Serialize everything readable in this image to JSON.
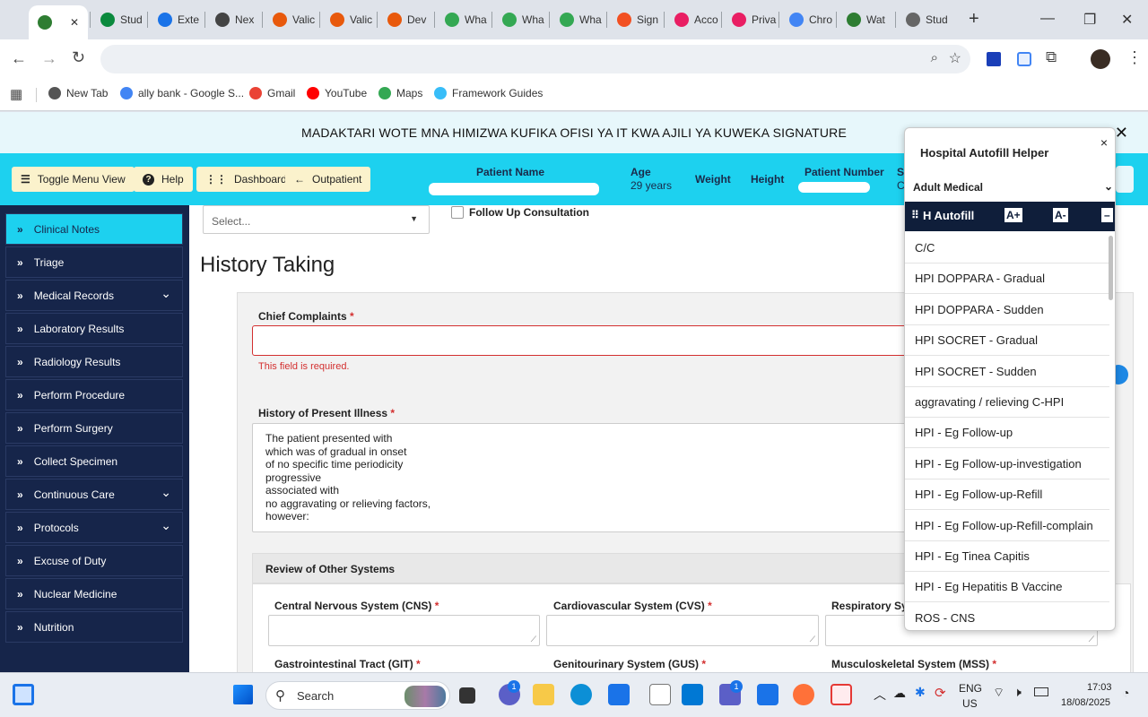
{
  "browser": {
    "tabs": [
      {
        "label": "",
        "color": "#2e7d32"
      },
      {
        "label": "Stud",
        "color": "#0b8a3e"
      },
      {
        "label": "Exte",
        "color": "#1a73e8"
      },
      {
        "label": "Nex",
        "color": "#444444"
      },
      {
        "label": "Valic",
        "color": "#e8590c"
      },
      {
        "label": "Valic",
        "color": "#e8590c"
      },
      {
        "label": "Dev",
        "color": "#e8590c"
      },
      {
        "label": "Wha",
        "color": "#34a853"
      },
      {
        "label": "Wha",
        "color": "#34a853"
      },
      {
        "label": "Wha",
        "color": "#34a853"
      },
      {
        "label": "Sign",
        "color": "#f25022"
      },
      {
        "label": "Acco",
        "color": "#e91e63"
      },
      {
        "label": "Priva",
        "color": "#e91e63"
      },
      {
        "label": "Chro",
        "color": "#4285f4"
      },
      {
        "label": "Wat",
        "color": "#2e7d32"
      },
      {
        "label": "Stud",
        "color": "#666666"
      }
    ],
    "new_tab_symbol": "+",
    "bookmarks": [
      {
        "label": "New Tab",
        "color": "#555555"
      },
      {
        "label": "ally bank - Google S...",
        "color": "#4285f4"
      },
      {
        "label": "Gmail",
        "color": "#ea4335"
      },
      {
        "label": "YouTube",
        "color": "#ff0000"
      },
      {
        "label": "Maps",
        "color": "#34a853"
      },
      {
        "label": "Framework Guides",
        "color": "#38bdf8"
      }
    ]
  },
  "banner": {
    "text": "MADAKTARI WOTE MNA HIMIZWA KUFIKA OFISI YA IT KWA AJILI YA KUWEKA SIGNATURE",
    "close": "✕"
  },
  "topbar": {
    "buttons": {
      "toggle": "Toggle Menu View",
      "help": "Help",
      "dashboard": "Dashboard",
      "outpatient": "Outpatient"
    },
    "patient": {
      "name_label": "Patient Name",
      "age_label": "Age",
      "age_value": "29 years",
      "weight_label": "Weight",
      "height_label": "Height",
      "number_label": "Patient Number",
      "s_label": "S",
      "s_value": "C"
    }
  },
  "sidebar": {
    "items": [
      {
        "label": "Clinical Notes",
        "dropdown": false
      },
      {
        "label": "Triage",
        "dropdown": false
      },
      {
        "label": "Medical Records",
        "dropdown": true
      },
      {
        "label": "Laboratory Results",
        "dropdown": false
      },
      {
        "label": "Radiology Results",
        "dropdown": false
      },
      {
        "label": "Perform Procedure",
        "dropdown": false
      },
      {
        "label": "Perform Surgery",
        "dropdown": false
      },
      {
        "label": "Collect Specimen",
        "dropdown": false
      },
      {
        "label": "Continuous Care",
        "dropdown": true
      },
      {
        "label": "Protocols",
        "dropdown": true
      },
      {
        "label": "Excuse of Duty",
        "dropdown": false
      },
      {
        "label": "Nuclear Medicine",
        "dropdown": false
      },
      {
        "label": "Nutrition",
        "dropdown": false
      }
    ]
  },
  "main": {
    "select_placeholder": "Select...",
    "follow_up": "Follow Up Consultation",
    "section_title": "History Taking",
    "chief_complaints": "Chief Complaints",
    "required_msg": "This field is required.",
    "hpi_label": "History of Present Illness",
    "hpi_lines": [
      "The patient presented with",
      "which was of gradual in onset",
      "of no specific time periodicity",
      "progressive",
      "associated with",
      "no aggravating or relieving factors,",
      "however:"
    ],
    "ros_title": "Review of Other Systems",
    "cns": "Central Nervous System (CNS)",
    "cvs": "Cardiovascular System (CVS)",
    "resp": "Respiratory Sys",
    "git": "Gastrointestinal Tract (GIT)",
    "gus": "Genitourinary System (GUS)",
    "mss": "Musculoskeletal System (MSS)"
  },
  "helper": {
    "title": "Hospital Autofill Helper",
    "close": "×",
    "profile": "Adult Medical",
    "bar_title": "H Autofill",
    "font_up": "A+",
    "font_down": "A-",
    "minimize": "–",
    "items": [
      "C/C",
      "HPI DOPPARA - Gradual",
      "HPI DOPPARA - Sudden",
      "HPI SOCRET - Gradual",
      "HPI SOCRET - Sudden",
      "aggravating / relieving C-HPI",
      "HPI - Eg Follow-up",
      "HPI - Eg Follow-up-investigation",
      "HPI - Eg Follow-up-Refill",
      "HPI - Eg Follow-up-Refill-complain",
      "HPI - Eg Tinea Capitis",
      "HPI - Eg Hepatitis B Vaccine",
      "ROS - CNS"
    ]
  },
  "taskbar": {
    "search": "Search",
    "lang": "ENG",
    "region": "US",
    "time": "17:03",
    "date": "18/08/2025",
    "badge1": "1",
    "badge2": "1"
  }
}
